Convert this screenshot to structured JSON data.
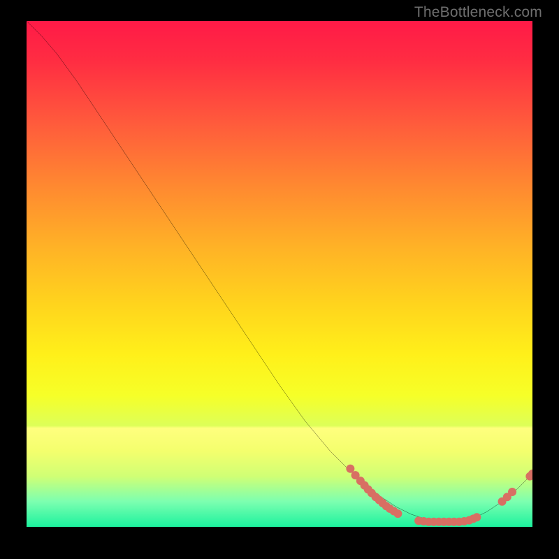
{
  "watermark": {
    "text": "TheBottleneck.com"
  },
  "chart_data": {
    "type": "line",
    "title": "",
    "xlabel": "",
    "ylabel": "",
    "xlim": [
      0,
      100
    ],
    "ylim": [
      0,
      100
    ],
    "grid": false,
    "series": [
      {
        "name": "curve",
        "x": [
          0,
          3,
          6,
          10,
          15,
          20,
          25,
          30,
          35,
          40,
          45,
          50,
          55,
          60,
          65,
          70,
          73,
          76,
          79,
          82,
          85,
          88,
          91,
          94,
          97,
          100
        ],
        "y": [
          100,
          97,
          93.5,
          88,
          80.5,
          73,
          65.5,
          58,
          50.5,
          43,
          35.5,
          28,
          21,
          15,
          10,
          6,
          4,
          2.5,
          1.5,
          1,
          1,
          1.5,
          3,
          5,
          7.5,
          10.5
        ],
        "color": "#000000",
        "width": 2
      }
    ],
    "points": {
      "name": "markers",
      "color": "#d86f63",
      "radius": 6,
      "xy": [
        [
          64,
          11.5
        ],
        [
          65,
          10.2
        ],
        [
          66,
          9.1
        ],
        [
          66.8,
          8.2
        ],
        [
          67.5,
          7.4
        ],
        [
          68.2,
          6.7
        ],
        [
          69,
          5.9
        ],
        [
          69.7,
          5.3
        ],
        [
          70.4,
          4.7
        ],
        [
          71.1,
          4.1
        ],
        [
          71.8,
          3.6
        ],
        [
          72.6,
          3.1
        ],
        [
          73.4,
          2.6
        ],
        [
          77.5,
          1.2
        ],
        [
          78.5,
          1.1
        ],
        [
          79.5,
          1.0
        ],
        [
          80.5,
          1.0
        ],
        [
          81.5,
          1.0
        ],
        [
          82.5,
          1.0
        ],
        [
          83.5,
          1.0
        ],
        [
          84.5,
          1.0
        ],
        [
          85.5,
          1.0
        ],
        [
          86.5,
          1.1
        ],
        [
          87.5,
          1.3
        ],
        [
          88.3,
          1.6
        ],
        [
          89.0,
          1.9
        ],
        [
          94.0,
          5.0
        ],
        [
          95.0,
          5.9
        ],
        [
          96.0,
          6.9
        ],
        [
          99.5,
          10.0
        ],
        [
          100.0,
          10.5
        ]
      ]
    },
    "background_gradient": {
      "top": "#ff1a47",
      "mid": "#ffe21f",
      "bottom": "#1cf29e"
    }
  }
}
